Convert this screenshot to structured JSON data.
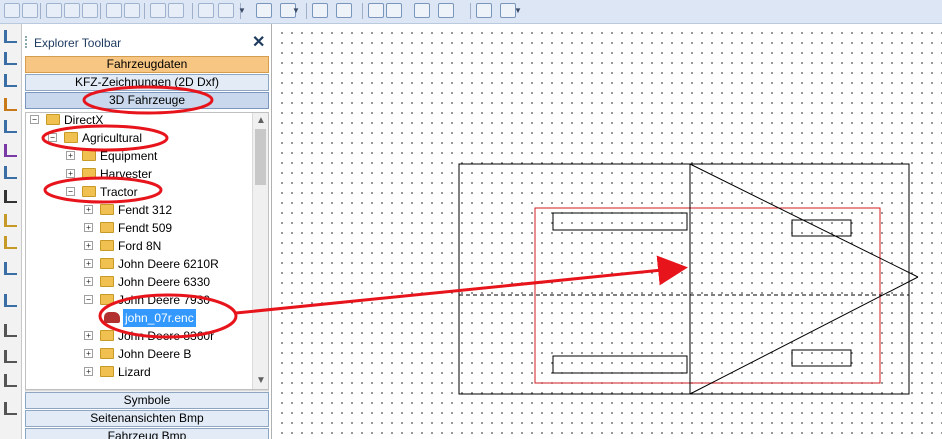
{
  "toolbar": {
    "icons": [
      "layer-icon",
      "layer-icon",
      "layer-icon",
      "layer-icon",
      "layer-icon",
      "layer-icon",
      "layer-icon",
      "layer-icon",
      "layer-icon",
      "gear-icon",
      "gear-icon",
      "grid-icon",
      "grid-icon",
      "grid-icon",
      "grid-icon",
      "grid-icon",
      "grid-icon",
      "grid-icon",
      "grid-icon",
      "grid-icon",
      "grid-icon"
    ]
  },
  "explorer": {
    "title": "Explorer Toolbar",
    "categories_top": [
      "Fahrzeugdaten",
      "KFZ-Zeichnungen (2D Dxf)",
      "3D Fahrzeuge"
    ],
    "categories_bottom": [
      "Symbole",
      "Seitenansichten Bmp",
      "Fahrzeug Bmp"
    ],
    "tree": [
      {
        "label": "DirectX",
        "level": 0,
        "expander": "−"
      },
      {
        "label": "Agricultural",
        "level": 1,
        "expander": "−"
      },
      {
        "label": "Equipment",
        "level": 2,
        "expander": "+"
      },
      {
        "label": "Harvester",
        "level": 2,
        "expander": "+"
      },
      {
        "label": "Tractor",
        "level": 2,
        "expander": "−"
      },
      {
        "label": "Fendt 312",
        "level": 3,
        "expander": "+"
      },
      {
        "label": "Fendt 509",
        "level": 3,
        "expander": "+"
      },
      {
        "label": "Ford 8N",
        "level": 3,
        "expander": "+"
      },
      {
        "label": "John Deere 6210R",
        "level": 3,
        "expander": "+"
      },
      {
        "label": "John Deere 6330",
        "level": 3,
        "expander": "+"
      },
      {
        "label": "John Deere 7930",
        "level": 3,
        "expander": "−"
      },
      {
        "label": "john_07r.enc",
        "level": 4,
        "expander": "",
        "file": true,
        "selected": true
      },
      {
        "label": "John Deere 8360r",
        "level": 3,
        "expander": "+"
      },
      {
        "label": "John Deere B",
        "level": 3,
        "expander": "+"
      },
      {
        "label": "Lizard",
        "level": 3,
        "expander": "+"
      }
    ]
  },
  "colors": {
    "annotation": "#e8141c",
    "drawing_line": "#000000",
    "drawing_red": "#d11b22",
    "selection": "#3399ff"
  }
}
